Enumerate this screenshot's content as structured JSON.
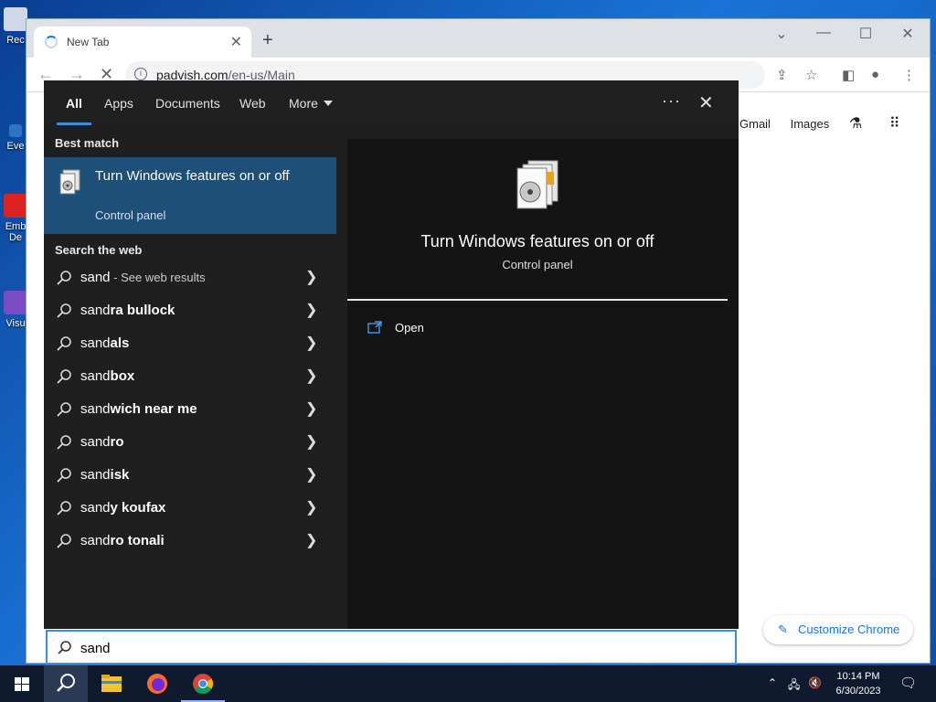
{
  "desktop": {
    "icons": [
      "Rec",
      "Eve",
      "Emb\nDe",
      "Visu"
    ]
  },
  "browser": {
    "tab_title": "New Tab",
    "url_host": "padvish.com",
    "url_path": "/en-us/Main",
    "ntp_links": [
      "Gmail",
      "Images"
    ],
    "customize_label": "Customize Chrome"
  },
  "search": {
    "tabs": [
      "All",
      "Apps",
      "Documents",
      "Web",
      "More"
    ],
    "active_tab": "All",
    "best_match_heading": "Best match",
    "best_match": {
      "title": "Turn Windows features on or off",
      "subtitle": "Control panel"
    },
    "web_heading": "Search the web",
    "web_results": [
      {
        "typed": "sand",
        "rest": "",
        "hint": " - See web results"
      },
      {
        "typed": "sand",
        "rest": "ra bullock",
        "hint": ""
      },
      {
        "typed": "sand",
        "rest": "als",
        "hint": ""
      },
      {
        "typed": "sand",
        "rest": "box",
        "hint": ""
      },
      {
        "typed": "sand",
        "rest": "wich near me",
        "hint": ""
      },
      {
        "typed": "sand",
        "rest": "ro",
        "hint": ""
      },
      {
        "typed": "sand",
        "rest": "isk",
        "hint": ""
      },
      {
        "typed": "sand",
        "rest": "y koufax",
        "hint": ""
      },
      {
        "typed": "sand",
        "rest": "ro tonali",
        "hint": ""
      }
    ],
    "preview": {
      "title": "Turn Windows features on or off",
      "subtitle": "Control panel",
      "action_open": "Open"
    },
    "query": "sand"
  },
  "taskbar": {
    "time": "10:14 PM",
    "date": "6/30/2023"
  },
  "colors": {
    "accent": "#3b8ede",
    "best_match_bg": "#1e4f78",
    "panel_bg": "#1f1f1f"
  }
}
